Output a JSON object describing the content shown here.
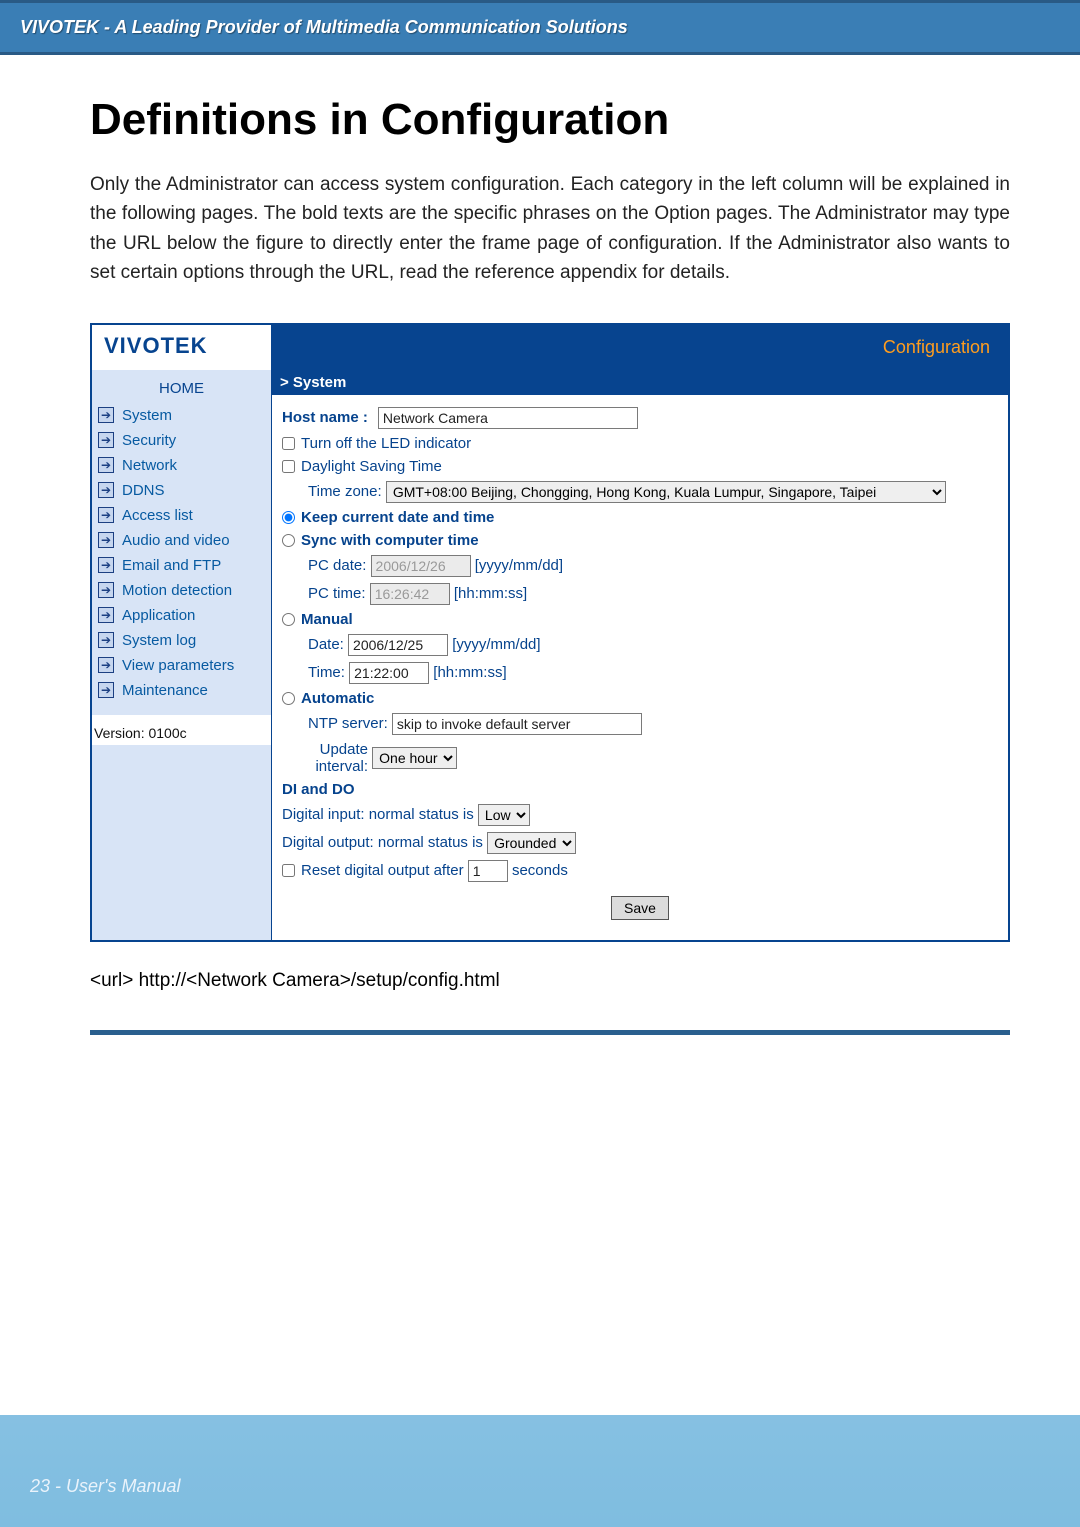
{
  "header": {
    "tagline": "VIVOTEK - A Leading Provider of Multimedia Communication Solutions"
  },
  "title": "Definitions in Configuration",
  "intro": "Only the Administrator can access system configuration. Each category in the left column will be explained in the following pages. The bold texts are the specific phrases on the Option pages. The Administrator may type the URL below the figure to directly enter the frame page of configuration. If the Administrator also wants to set certain options through the URL, read the reference appendix for details.",
  "config": {
    "logo": "VIVOTEK",
    "title": "Configuration",
    "sidebar": {
      "home": "HOME",
      "items": [
        {
          "label": "System"
        },
        {
          "label": "Security"
        },
        {
          "label": "Network"
        },
        {
          "label": "DDNS"
        },
        {
          "label": "Access list"
        },
        {
          "label": "Audio and video"
        },
        {
          "label": "Email and FTP"
        },
        {
          "label": "Motion detection"
        },
        {
          "label": "Application"
        },
        {
          "label": "System log"
        },
        {
          "label": "View parameters"
        },
        {
          "label": "Maintenance"
        }
      ],
      "version": "Version: 0100c"
    },
    "system": {
      "section": "> System",
      "host_name_label": "Host name :",
      "host_name_value": "Network Camera",
      "turn_off_led": "Turn off the LED indicator",
      "daylight": "Daylight Saving Time",
      "time_zone_label": "Time zone:",
      "time_zone_value": "GMT+08:00 Beijing, Chongging, Hong Kong, Kuala Lumpur, Singapore, Taipei",
      "keep_current": "Keep current date and time",
      "sync_computer": "Sync with computer time",
      "pc_date_label": "PC date:",
      "pc_date_value": "2006/12/26",
      "pc_date_hint": "[yyyy/mm/dd]",
      "pc_time_label": "PC time:",
      "pc_time_value": "16:26:42",
      "pc_time_hint": "[hh:mm:ss]",
      "manual": "Manual",
      "manual_date_label": "Date:",
      "manual_date_value": "2006/12/25",
      "manual_date_hint": "[yyyy/mm/dd]",
      "manual_time_label": "Time:",
      "manual_time_value": "21:22:00",
      "manual_time_hint": "[hh:mm:ss]",
      "automatic": "Automatic",
      "ntp_label": "NTP server:",
      "ntp_value": "skip to invoke default server",
      "update_interval_label": "Update interval:",
      "update_interval_value": "One hour",
      "di_do": "DI and DO",
      "di_label": "Digital input: normal status is",
      "di_value": "Low",
      "do_label": "Digital output: normal status is",
      "do_value": "Grounded",
      "reset_label": "Reset digital output after",
      "reset_value": "1",
      "reset_unit": "seconds",
      "save": "Save"
    }
  },
  "url_line": "<url> http://<Network Camera>/setup/config.html",
  "footer": "23 - User's Manual"
}
